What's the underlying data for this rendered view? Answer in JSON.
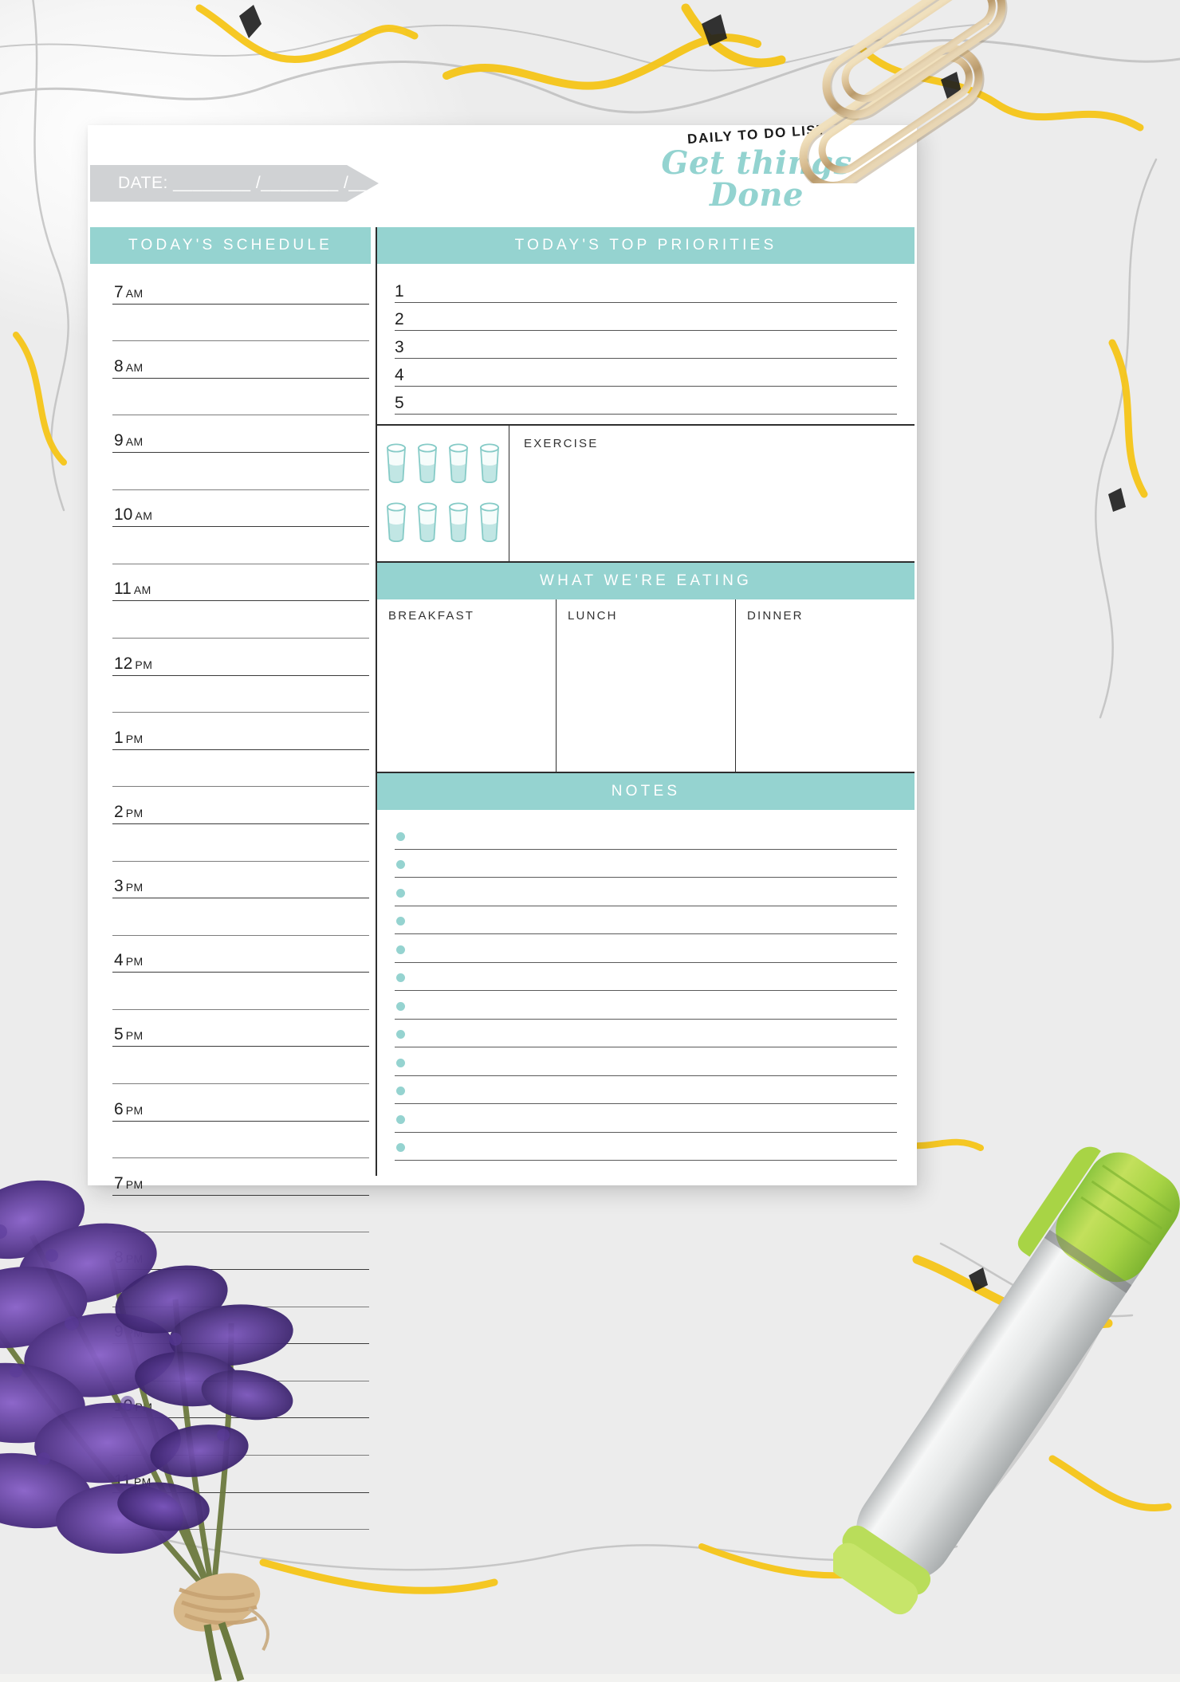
{
  "document": {
    "kind": "printable-daily-planner",
    "brand_kicker": "DAILY TO DO LIST",
    "brand_title": "Get things Done",
    "date_label": "DATE: ________ /________ /________"
  },
  "colors": {
    "accent_teal": "#95d3d0",
    "date_banner_gray": "#d0d2d4",
    "ink": "#1e1e1e",
    "rule_dark": "#3a3a3a",
    "rule_light": "#7d7d7d",
    "paper": "#ffffff"
  },
  "schedule": {
    "header": "TODAY'S SCHEDULE",
    "rows": [
      {
        "hour": "7",
        "meridiem": "AM"
      },
      {
        "hour": "",
        "meridiem": ""
      },
      {
        "hour": "8",
        "meridiem": "AM"
      },
      {
        "hour": "",
        "meridiem": ""
      },
      {
        "hour": "9",
        "meridiem": "AM"
      },
      {
        "hour": "",
        "meridiem": ""
      },
      {
        "hour": "10",
        "meridiem": "AM"
      },
      {
        "hour": "",
        "meridiem": ""
      },
      {
        "hour": "11",
        "meridiem": "AM"
      },
      {
        "hour": "",
        "meridiem": ""
      },
      {
        "hour": "12",
        "meridiem": "PM"
      },
      {
        "hour": "",
        "meridiem": ""
      },
      {
        "hour": "1",
        "meridiem": "PM"
      },
      {
        "hour": "",
        "meridiem": ""
      },
      {
        "hour": "2",
        "meridiem": "PM"
      },
      {
        "hour": "",
        "meridiem": ""
      },
      {
        "hour": "3",
        "meridiem": "PM"
      },
      {
        "hour": "",
        "meridiem": ""
      },
      {
        "hour": "4",
        "meridiem": "PM"
      },
      {
        "hour": "",
        "meridiem": ""
      },
      {
        "hour": "5",
        "meridiem": "PM"
      },
      {
        "hour": "",
        "meridiem": ""
      },
      {
        "hour": "6",
        "meridiem": "PM"
      },
      {
        "hour": "",
        "meridiem": ""
      },
      {
        "hour": "7",
        "meridiem": "PM"
      },
      {
        "hour": "",
        "meridiem": ""
      },
      {
        "hour": "8",
        "meridiem": "PM"
      },
      {
        "hour": "",
        "meridiem": ""
      },
      {
        "hour": "9",
        "meridiem": "PM"
      },
      {
        "hour": "",
        "meridiem": ""
      },
      {
        "hour": "10",
        "meridiem": "PM"
      },
      {
        "hour": "",
        "meridiem": ""
      },
      {
        "hour": "11",
        "meridiem": "PM"
      },
      {
        "hour": "",
        "meridiem": ""
      }
    ]
  },
  "priorities": {
    "header": "TODAY'S TOP PRIORITIES",
    "items": [
      {
        "num": "1",
        "value": ""
      },
      {
        "num": "2",
        "value": ""
      },
      {
        "num": "3",
        "value": ""
      },
      {
        "num": "4",
        "value": ""
      },
      {
        "num": "5",
        "value": ""
      }
    ]
  },
  "water": {
    "total_glasses": 8,
    "rows": 2,
    "per_row": 4,
    "checked": 0
  },
  "exercise": {
    "label": "EXERCISE",
    "value": ""
  },
  "eating": {
    "header": "WHAT WE'RE EATING",
    "meals": [
      {
        "label": "BREAKFAST",
        "value": ""
      },
      {
        "label": "LUNCH",
        "value": ""
      },
      {
        "label": "DINNER",
        "value": ""
      }
    ]
  },
  "notes": {
    "header": "NOTES",
    "line_count": 12,
    "lines": [
      "",
      "",
      "",
      "",
      "",
      "",
      "",
      "",
      "",
      "",
      "",
      ""
    ]
  },
  "decorations": [
    {
      "name": "gold-paperclips",
      "count": 2
    },
    {
      "name": "green-marker-pen",
      "count": 1
    },
    {
      "name": "lavender-bouquet",
      "count": 1
    }
  ]
}
